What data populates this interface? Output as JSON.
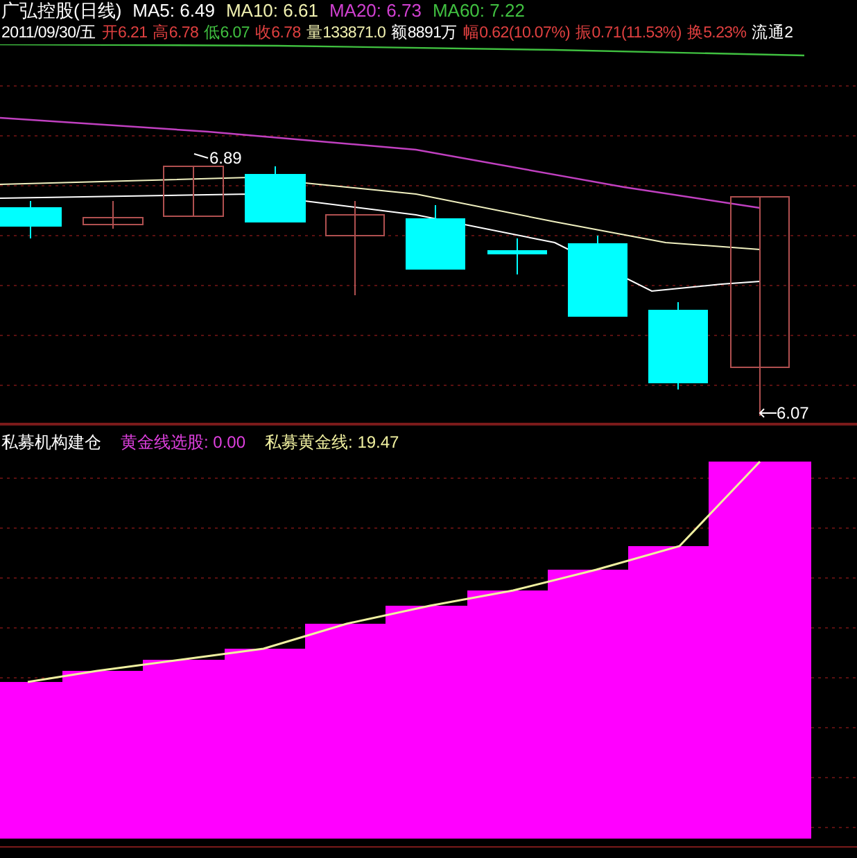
{
  "title_line": [
    {
      "text": "广弘控股(日线)",
      "color": "#ffffff"
    },
    {
      "text": "MA5: 6.49",
      "color": "#ffffff"
    },
    {
      "text": "MA10: 6.61",
      "color": "#f0f0b0"
    },
    {
      "text": "MA20: 6.73",
      "color": "#d040d0"
    },
    {
      "text": "MA60: 7.22",
      "color": "#40c040"
    }
  ],
  "quote_line": [
    {
      "text": "2011/09/30/五",
      "color": "#ffffff"
    },
    {
      "text": "开6.21",
      "color": "#e04040"
    },
    {
      "text": "高6.78",
      "color": "#e04040"
    },
    {
      "text": "低6.07",
      "color": "#40c040"
    },
    {
      "text": "收6.78",
      "color": "#e04040"
    },
    {
      "text": "量133871.0",
      "color": "#f0f0b0"
    },
    {
      "text": "额8891万",
      "color": "#ffffff"
    },
    {
      "text": "幅0.62(10.07%)",
      "color": "#e04040"
    },
    {
      "text": "振0.71(11.53%)",
      "color": "#e04040"
    },
    {
      "text": "换5.23%",
      "color": "#e04040"
    },
    {
      "text": "流通2",
      "color": "#ffffff"
    }
  ],
  "price_chart": {
    "high_label": "6.89",
    "low_label": "6.07"
  },
  "indicator_title": [
    {
      "text": "私募机构建仓",
      "color": "#ffffff"
    },
    {
      "text": "黄金线选股: 0.00",
      "color": "#e040e0"
    },
    {
      "text": "私募黄金线: 19.47",
      "color": "#f0f0a0"
    }
  ]
}
